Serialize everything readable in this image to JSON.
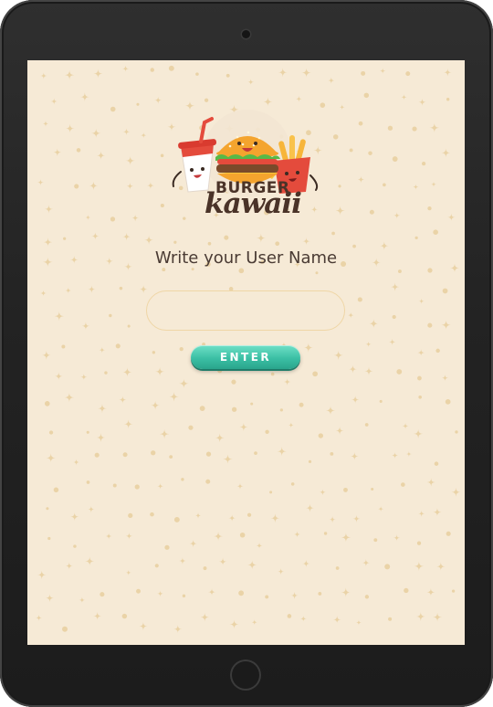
{
  "app": {
    "brand_line1": "BURGER",
    "brand_line2": "kawaii"
  },
  "login": {
    "prompt": "Write your User Name",
    "input_value": "",
    "enter_label": "ENTER"
  },
  "colors": {
    "background": "#f6ead6",
    "sparkle": "#ead3a7",
    "accent": "#3bbfa4",
    "text": "#4a3b34",
    "device": "#262626"
  },
  "icons": [
    "soda-cup-icon",
    "burger-icon",
    "fries-icon"
  ]
}
